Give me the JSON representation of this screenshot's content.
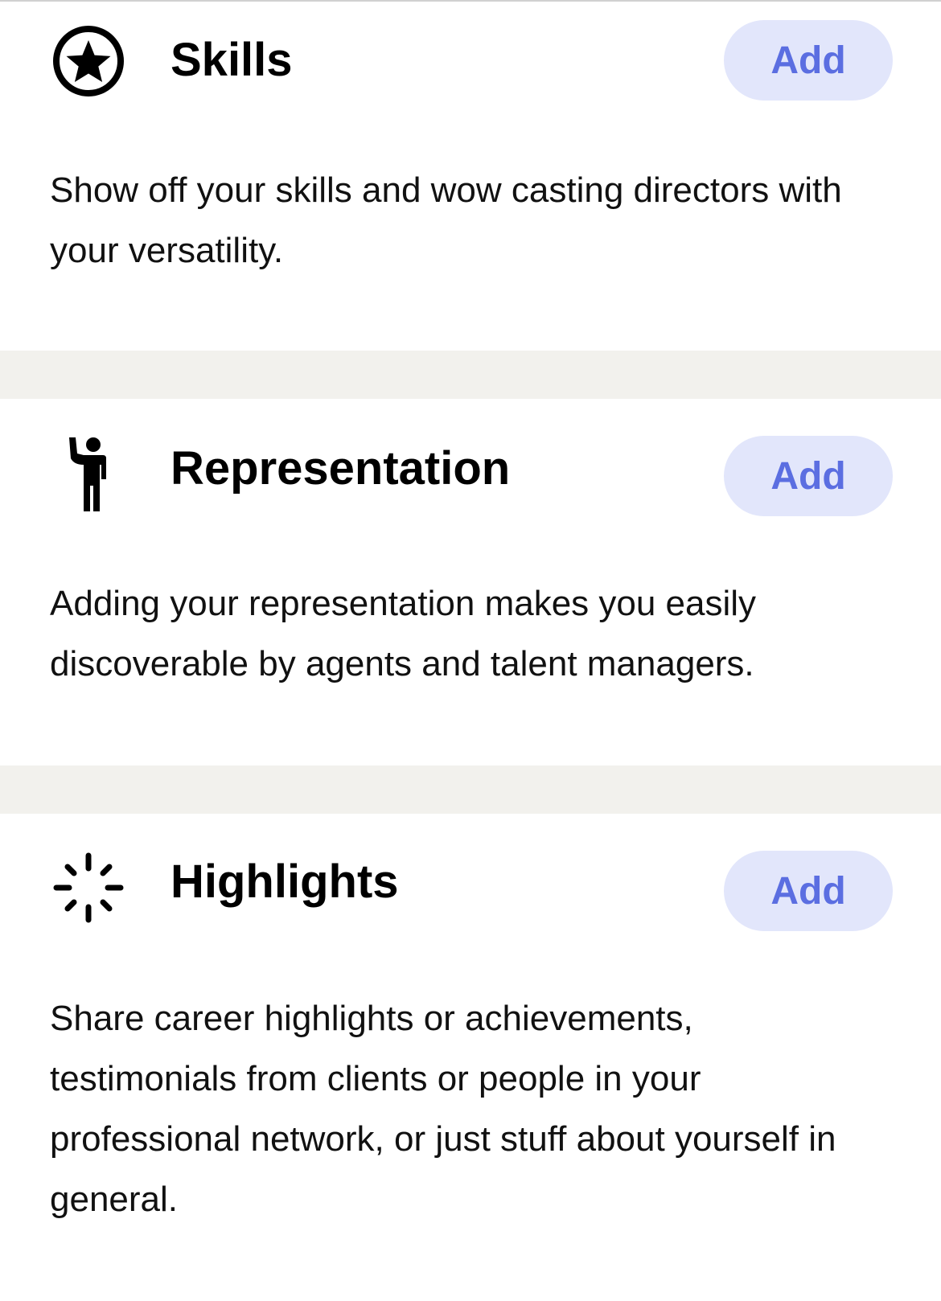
{
  "sections": [
    {
      "id": "skills",
      "icon": "star-circle-icon",
      "title": "Skills",
      "button_label": "Add",
      "description": "Show off your skills and wow casting directors with your versatility."
    },
    {
      "id": "representation",
      "icon": "person-raising-hand-icon",
      "title": "Representation",
      "button_label": "Add",
      "description": "Adding your representation makes you easily discoverable by agents and talent managers."
    },
    {
      "id": "highlights",
      "icon": "sparkle-burst-icon",
      "title": "Highlights",
      "button_label": "Add",
      "description": "Share career highlights or achievements, testimonials from clients or people in your professional network, or just stuff about yourself in general."
    }
  ],
  "colors": {
    "accent_text": "#5b6ee1",
    "button_bg": "#e2e6fb",
    "divider": "#f2f1ed"
  }
}
